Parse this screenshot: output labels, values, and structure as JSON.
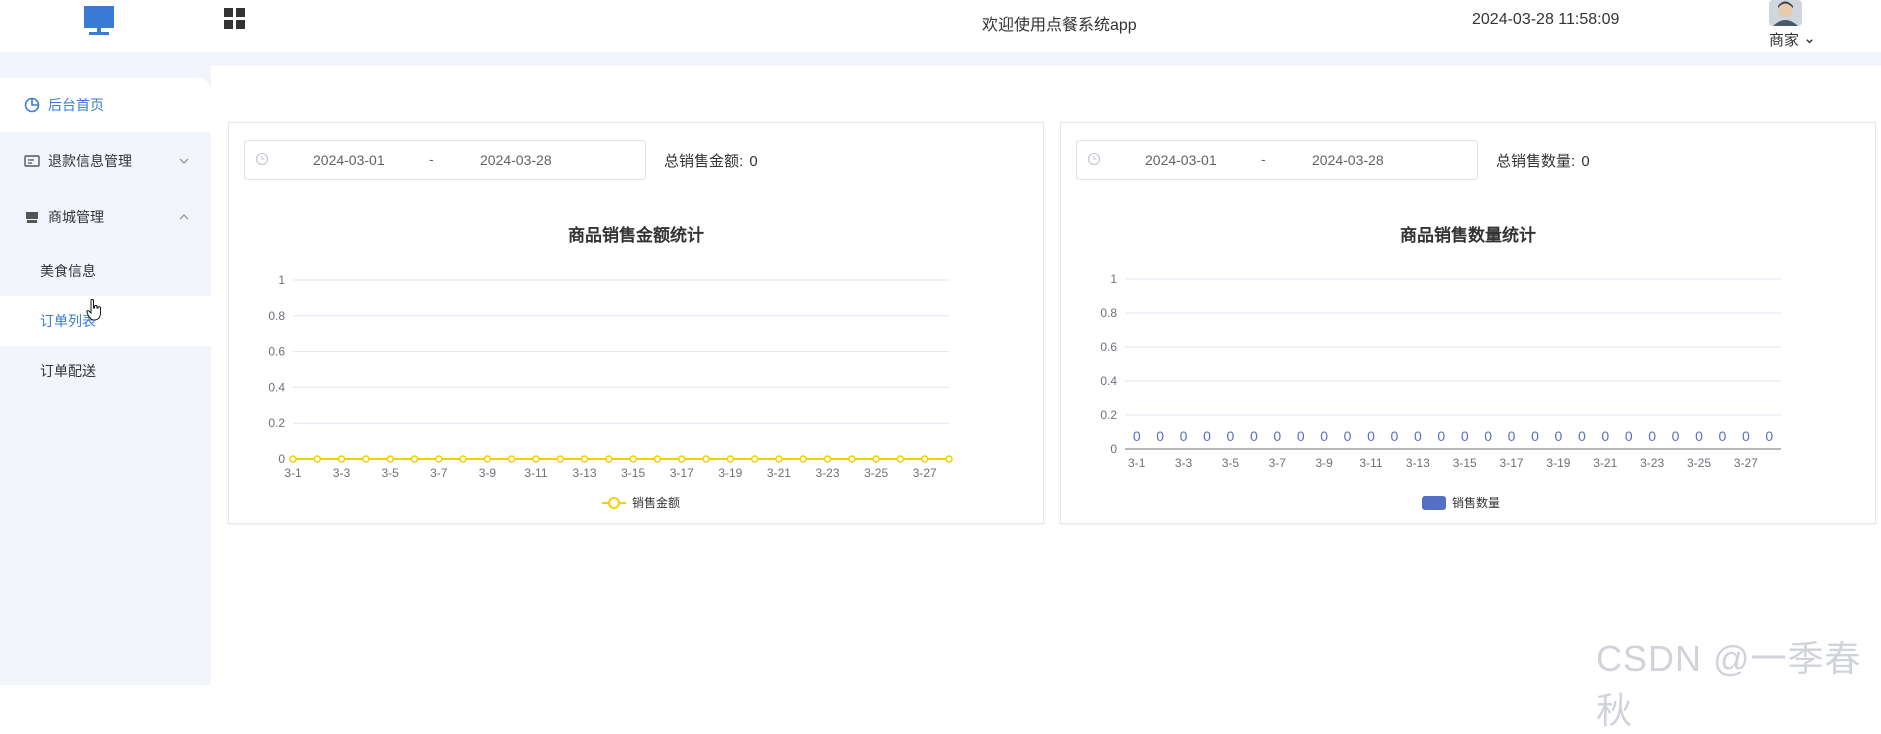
{
  "header": {
    "welcome": "欢迎使用点餐系统app",
    "datetime": "2024-03-28 11:58:09",
    "user_label": "商家",
    "logo_icon": "monitor-icon",
    "apps_icon": "grid-icon",
    "accent": "#3a7bd5"
  },
  "sidebar": {
    "items": [
      {
        "label": "后台首页",
        "icon": "pie-chart-icon",
        "active": true
      },
      {
        "label": "退款信息管理",
        "icon": "card-icon",
        "expanded": false
      },
      {
        "label": "商城管理",
        "icon": "shop-icon",
        "expanded": true
      }
    ],
    "subitems": [
      {
        "label": "美食信息"
      },
      {
        "label": "订单列表",
        "active": true
      },
      {
        "label": "订单配送"
      }
    ]
  },
  "cards": [
    {
      "start_date": "2024-03-01",
      "separator": "-",
      "end_date": "2024-03-28",
      "total_label": "总销售金额:",
      "total_value": "0"
    },
    {
      "start_date": "2024-03-01",
      "separator": "-",
      "end_date": "2024-03-28",
      "total_label": "总销售数量:",
      "total_value": "0"
    }
  ],
  "chart_data": [
    {
      "type": "line",
      "title": "商品销售金额统计",
      "x": [
        "3-1",
        "3-2",
        "3-3",
        "3-4",
        "3-5",
        "3-6",
        "3-7",
        "3-8",
        "3-9",
        "3-10",
        "3-11",
        "3-12",
        "3-13",
        "3-14",
        "3-15",
        "3-16",
        "3-17",
        "3-18",
        "3-19",
        "3-20",
        "3-21",
        "3-22",
        "3-23",
        "3-24",
        "3-25",
        "3-26",
        "3-27",
        "3-28"
      ],
      "x_tick_labels": [
        "3-1",
        "3-3",
        "3-5",
        "3-7",
        "3-9",
        "3-11",
        "3-13",
        "3-15",
        "3-17",
        "3-19",
        "3-21",
        "3-23",
        "3-25",
        "3-27"
      ],
      "series": [
        {
          "name": "销售金额",
          "values": [
            0,
            0,
            0,
            0,
            0,
            0,
            0,
            0,
            0,
            0,
            0,
            0,
            0,
            0,
            0,
            0,
            0,
            0,
            0,
            0,
            0,
            0,
            0,
            0,
            0,
            0,
            0,
            0
          ],
          "color": "#f5d000"
        }
      ],
      "ylim": [
        0,
        1
      ],
      "yticks": [
        "0",
        "0.2",
        "0.4",
        "0.6",
        "0.8",
        "1"
      ],
      "grid": true,
      "legend": "bottom-center"
    },
    {
      "type": "bar",
      "title": "商品销售数量统计",
      "x": [
        "3-1",
        "3-2",
        "3-3",
        "3-4",
        "3-5",
        "3-6",
        "3-7",
        "3-8",
        "3-9",
        "3-10",
        "3-11",
        "3-12",
        "3-13",
        "3-14",
        "3-15",
        "3-16",
        "3-17",
        "3-18",
        "3-19",
        "3-20",
        "3-21",
        "3-22",
        "3-23",
        "3-24",
        "3-25",
        "3-26",
        "3-27",
        "3-28"
      ],
      "x_tick_labels": [
        "3-1",
        "3-3",
        "3-5",
        "3-7",
        "3-9",
        "3-11",
        "3-13",
        "3-15",
        "3-17",
        "3-19",
        "3-21",
        "3-23",
        "3-25",
        "3-27"
      ],
      "series": [
        {
          "name": "销售数量",
          "values": [
            0,
            0,
            0,
            0,
            0,
            0,
            0,
            0,
            0,
            0,
            0,
            0,
            0,
            0,
            0,
            0,
            0,
            0,
            0,
            0,
            0,
            0,
            0,
            0,
            0,
            0,
            0,
            0
          ],
          "color": "#5470c6"
        }
      ],
      "data_labels": true,
      "ylim": [
        0,
        1
      ],
      "yticks": [
        "0",
        "0.2",
        "0.4",
        "0.6",
        "0.8",
        "1"
      ],
      "grid": true,
      "legend": "bottom-center"
    }
  ],
  "watermark": "CSDN @一季春秋"
}
